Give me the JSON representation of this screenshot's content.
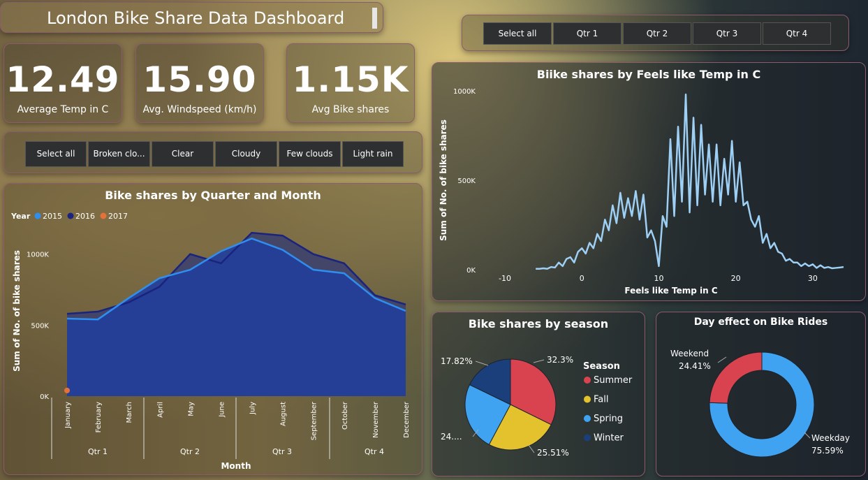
{
  "header": {
    "title": "London Bike Share Data Dashboard"
  },
  "kpis": [
    {
      "value": "12.49",
      "label": "Average Temp in C"
    },
    {
      "value": "15.90",
      "label": "Avg. Windspeed (km/h)"
    },
    {
      "value": "1.15K",
      "label": "Avg Bike shares"
    }
  ],
  "weather_slicer": [
    "Select all",
    "Broken clo...",
    "Clear",
    "Cloudy",
    "Few clouds",
    "Light rain"
  ],
  "quarter_slicer": [
    "Select all",
    "Qtr 1",
    "Qtr 2",
    "Qtr 3",
    "Qtr 4"
  ],
  "colors": {
    "y2015": "#2f8ff0",
    "y2016": "#1a237e",
    "y2017": "#e4703a",
    "area": "#233f9a",
    "temp_line": "#9ecff5",
    "summer": "#d9434f",
    "fall": "#e3c22e",
    "spring": "#3fa3f2",
    "winter": "#1b3f7a"
  },
  "chart_data": [
    {
      "id": "quarter_month",
      "type": "area",
      "title": "Bike shares by Quarter and Month",
      "legend_title": "Year",
      "xlabel": "Month",
      "ylabel": "Sum of No. of bike shares",
      "ylim": [
        0,
        1200000
      ],
      "yticks": [
        {
          "v": 0,
          "t": "0K"
        },
        {
          "v": 500000,
          "t": "500K"
        },
        {
          "v": 1000000,
          "t": "1000K"
        }
      ],
      "categories": [
        "January",
        "February",
        "March",
        "April",
        "May",
        "June",
        "July",
        "August",
        "September",
        "October",
        "November",
        "December"
      ],
      "quarters": [
        "Qtr 1",
        "Qtr 2",
        "Qtr 3",
        "Qtr 4"
      ],
      "series": [
        {
          "name": "2015",
          "values": [
            546000,
            540000,
            690000,
            830000,
            890000,
            1020000,
            1110000,
            1030000,
            890000,
            865000,
            690000,
            600000
          ]
        },
        {
          "name": "2016",
          "values": [
            580000,
            595000,
            660000,
            770000,
            1000000,
            935000,
            1150000,
            1130000,
            1000000,
            935000,
            710000,
            645000
          ]
        },
        {
          "name": "2017",
          "values": [
            40000
          ]
        }
      ]
    },
    {
      "id": "feels_like",
      "type": "line",
      "title": "Biike shares by Feels like Temp in C",
      "xlabel": "Feels like Temp in C",
      "ylabel": "Sum of No. of bike shares",
      "xlim": [
        -12,
        35
      ],
      "ylim": [
        0,
        1000000
      ],
      "xticks": [
        -10,
        0,
        10,
        20,
        30
      ],
      "yticks": [
        {
          "v": 0,
          "t": "0K"
        },
        {
          "v": 500000,
          "t": "500K"
        },
        {
          "v": 1000000,
          "t": "1000K"
        }
      ],
      "x": [
        -6,
        -5.5,
        -5,
        -4.5,
        -4,
        -3.5,
        -3,
        -2.5,
        -2,
        -1.5,
        -1,
        -0.5,
        0,
        0.5,
        1,
        1.5,
        2,
        2.5,
        3,
        3.5,
        4,
        4.5,
        5,
        5.5,
        6,
        6.5,
        7,
        7.5,
        8,
        8.5,
        9,
        9.5,
        10,
        10.5,
        11,
        11.5,
        12,
        12.5,
        13,
        13.5,
        14,
        14.5,
        15,
        15.5,
        16,
        16.5,
        17,
        17.5,
        18,
        18.5,
        19,
        19.5,
        20,
        20.5,
        21,
        21.5,
        22,
        22.5,
        23,
        23.5,
        24,
        24.5,
        25,
        25.5,
        26,
        26.5,
        27,
        27.5,
        28,
        28.5,
        29,
        29.5,
        30,
        30.5,
        31,
        31.5,
        32,
        32.5,
        33,
        33.5,
        34
      ],
      "y": [
        5000,
        5000,
        8000,
        5000,
        15000,
        12000,
        40000,
        20000,
        60000,
        70000,
        40000,
        100000,
        120000,
        90000,
        150000,
        120000,
        200000,
        160000,
        280000,
        220000,
        360000,
        260000,
        430000,
        290000,
        400000,
        300000,
        440000,
        280000,
        420000,
        180000,
        220000,
        160000,
        20000,
        300000,
        240000,
        730000,
        300000,
        800000,
        380000,
        980000,
        320000,
        850000,
        360000,
        810000,
        420000,
        700000,
        380000,
        700000,
        360000,
        620000,
        420000,
        720000,
        380000,
        600000,
        360000,
        380000,
        280000,
        240000,
        300000,
        150000,
        200000,
        120000,
        150000,
        100000,
        90000,
        50000,
        60000,
        40000,
        40000,
        20000,
        35000,
        20000,
        30000,
        10000,
        25000,
        10000,
        15000,
        8000,
        10000,
        12000,
        15000
      ]
    },
    {
      "id": "season",
      "type": "pie",
      "title": "Bike shares by season",
      "legend_title": "Season",
      "slices": [
        {
          "name": "Summer",
          "value": 32.3,
          "label": "32.3%"
        },
        {
          "name": "Fall",
          "value": 25.51,
          "label": "25.51%"
        },
        {
          "name": "Spring",
          "value": 24.37,
          "label": "24...."
        },
        {
          "name": "Winter",
          "value": 17.82,
          "label": "17.82%"
        }
      ]
    },
    {
      "id": "day_effect",
      "type": "pie",
      "title": "Day effect on Bike Rides",
      "slices": [
        {
          "name": "Weekday",
          "value": 75.59,
          "label": "75.59%"
        },
        {
          "name": "Weekend",
          "value": 24.41,
          "label": "24.41%"
        }
      ]
    }
  ]
}
